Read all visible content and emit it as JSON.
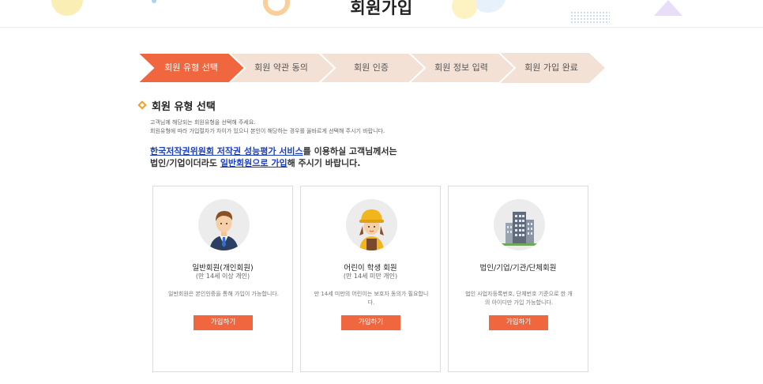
{
  "page": {
    "title": "회원가입"
  },
  "steps": [
    {
      "label": "회원 유형 선택",
      "active": true
    },
    {
      "label": "회원 약관 동의",
      "active": false
    },
    {
      "label": "회원 인증",
      "active": false
    },
    {
      "label": "회원 정보 입력",
      "active": false
    },
    {
      "label": "회원 가입 완료",
      "active": false
    }
  ],
  "section": {
    "title": "회원 유형 선택",
    "desc_line1": "고객님께 해당되는 회원유형을 선택해 주세요.",
    "desc_line2": "회원유형에 따라 가입절차가 차이가 있으니 본인이 해당하는 경우를 올바르게 선택해 주시기 바랍니다.",
    "notice": {
      "link1": "한국저작권위원회 저작권 성능평가 서비스",
      "text1": "를 이용하실 고객님께서는",
      "text2": "법인/기업이더라도 ",
      "link2": "일반회원으로 가입",
      "text3": "해 주시기 바랍니다."
    }
  },
  "cards": [
    {
      "title": "일반회원(개인회원)",
      "sub": "(만 14세 이상 개인)",
      "desc": "일반회원은 본인인증을 통해 가입이 가능합니다.",
      "button": "가입하기",
      "icon": "businessman-icon"
    },
    {
      "title": "어린이 학생 회원",
      "sub": "(만 14세 미만 개인)",
      "desc": "만 14세 미만의 어린이는 보호자 동의가 필요합니다.",
      "button": "가입하기",
      "icon": "child-hardhat-icon"
    },
    {
      "title": "법인/기업/기관/단체회원",
      "sub": "",
      "desc": "법인 사업자등록번호, 단체번호 기준으로 한 개의 아이디만 가입 가능합니다.",
      "button": "가입하기",
      "icon": "building-icon"
    }
  ],
  "colors": {
    "accent": "#f0663e",
    "step_inactive": "#f3e1d6",
    "link": "#1a3fbf",
    "diamond": "#f0a020"
  }
}
